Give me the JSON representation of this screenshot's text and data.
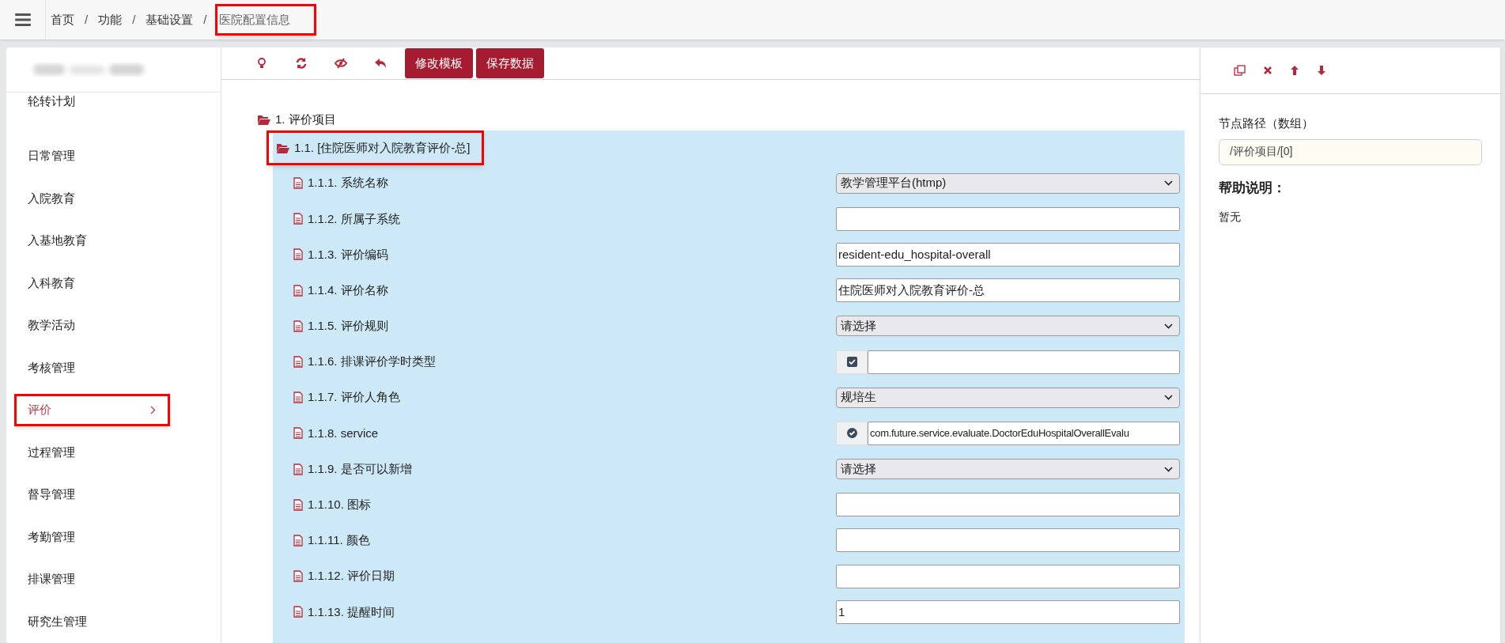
{
  "breadcrumb": [
    {
      "label": "首页",
      "current": false,
      "highlight": false
    },
    {
      "kind": "separator",
      "label": "/"
    },
    {
      "label": "功能",
      "current": false,
      "highlight": false
    },
    {
      "kind": "separator",
      "label": "/"
    },
    {
      "label": "基础设置",
      "current": false,
      "highlight": false
    },
    {
      "kind": "separator",
      "label": "/"
    },
    {
      "label": "医院配置信息",
      "current": true,
      "highlight": true
    }
  ],
  "sidebar": {
    "items": [
      {
        "label": "轮转计划",
        "selected": false,
        "highlight": false
      },
      {
        "label": "日常管理",
        "selected": false,
        "highlight": false
      },
      {
        "label": "入院教育",
        "selected": false,
        "highlight": false
      },
      {
        "label": "入基地教育",
        "selected": false,
        "highlight": false
      },
      {
        "label": "入科教育",
        "selected": false,
        "highlight": false
      },
      {
        "label": "教学活动",
        "selected": false,
        "highlight": false
      },
      {
        "label": "考核管理",
        "selected": false,
        "highlight": false
      },
      {
        "label": "评价",
        "selected": true,
        "highlight": true
      },
      {
        "label": "过程管理",
        "selected": false,
        "highlight": false
      },
      {
        "label": "督导管理",
        "selected": false,
        "highlight": false
      },
      {
        "label": "考勤管理",
        "selected": false,
        "highlight": false
      },
      {
        "label": "排课管理",
        "selected": false,
        "highlight": false
      },
      {
        "label": "研究生管理",
        "selected": false,
        "highlight": false
      }
    ]
  },
  "toolbar": {
    "icons": [
      {
        "kind": "bulb"
      },
      {
        "kind": "refresh"
      },
      {
        "kind": "eye-off"
      },
      {
        "kind": "undo"
      }
    ],
    "buttons": [
      "修改模板",
      "保存数据"
    ]
  },
  "tree": {
    "label": "1. 评价项目",
    "children": [
      {
        "label": "1.1. [住院医师对入院教育评价-总]",
        "highlight": true,
        "selected": true,
        "fields": [
          {
            "label": "1.1.1. 系统名称",
            "kind": "select",
            "value": "教学管理平台(htmp)"
          },
          {
            "label": "1.1.2. 所属子系统",
            "kind": "text"
          },
          {
            "label": "1.1.3. 评价编码",
            "kind": "text",
            "value": "resident-edu_hospital-overall"
          },
          {
            "label": "1.1.4. 评价名称",
            "kind": "text",
            "value": "住院医师对入院教育评价-总"
          },
          {
            "label": "1.1.5. 评价规则",
            "kind": "select",
            "value": "请选择"
          },
          {
            "label": "1.1.6. 排课评价学时类型",
            "kind": "text",
            "addon": {
              "kind": "check-square"
            }
          },
          {
            "label": "1.1.7. 评价人角色",
            "kind": "select",
            "value": "规培生"
          },
          {
            "label": "1.1.8. service",
            "kind": "text",
            "addon": {
              "kind": "check-circle"
            },
            "value": "com.future.service.evaluate.DoctorEduHospitalOverallEvalu"
          },
          {
            "label": "1.1.9. 是否可以新增",
            "kind": "select",
            "value": "请选择"
          },
          {
            "label": "1.1.10. 图标",
            "kind": "text"
          },
          {
            "label": "1.1.11. 颜色",
            "kind": "text"
          },
          {
            "label": "1.1.12. 评价日期",
            "kind": "text"
          },
          {
            "label": "1.1.13. 提醒时间",
            "kind": "text",
            "value": "1"
          }
        ]
      }
    ]
  },
  "right_panel": {
    "icons": [
      {
        "kind": "copy"
      },
      {
        "kind": "close"
      },
      {
        "kind": "arrow-up"
      },
      {
        "kind": "arrow-down"
      }
    ],
    "path_label": "节点路径（数组）",
    "path_value": "/评价项目/[0]",
    "help_title": "帮助说明：",
    "help_text": "暂无"
  }
}
